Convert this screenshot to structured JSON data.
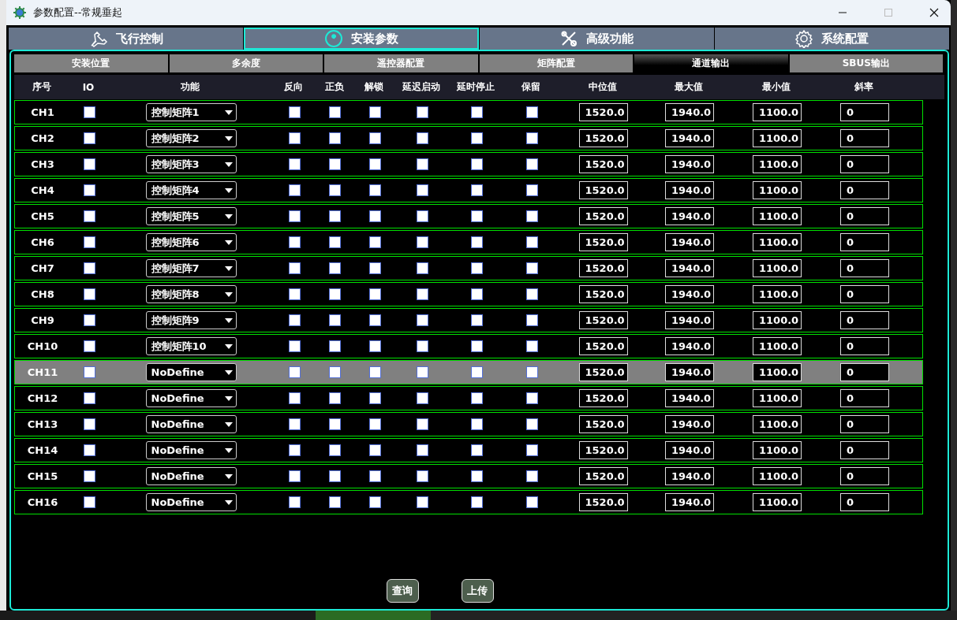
{
  "window": {
    "title": "参数配置--常规垂起"
  },
  "main_tabs": [
    {
      "label": "飞行控制",
      "selected": false
    },
    {
      "label": "安装参数",
      "selected": true
    },
    {
      "label": "高级功能",
      "selected": false
    },
    {
      "label": "系统配置",
      "selected": false
    }
  ],
  "sub_tabs": [
    {
      "label": "安装位置",
      "selected": false
    },
    {
      "label": "多余度",
      "selected": false
    },
    {
      "label": "遥控器配置",
      "selected": false
    },
    {
      "label": "矩阵配置",
      "selected": false
    },
    {
      "label": "通道输出",
      "selected": true
    },
    {
      "label": "SBUS输出",
      "selected": false
    }
  ],
  "table": {
    "columns": [
      "序号",
      "IO",
      "功能",
      "反向",
      "正负",
      "解锁",
      "延迟启动",
      "延时停止",
      "保留",
      "中位值",
      "最大值",
      "最小值",
      "斜率"
    ],
    "rows": [
      {
        "channel": "CH1",
        "selected": false,
        "checks": [
          {
            "checked": false
          },
          {
            "checked": false
          },
          {
            "checked": false
          },
          {
            "checked": false
          },
          {
            "checked": false
          },
          {
            "checked": false
          },
          {
            "checked": false
          }
        ],
        "function": "控制矩阵1",
        "mid": "1520.0",
        "max": "1940.0",
        "min": "1100.0",
        "slope": "0"
      },
      {
        "channel": "CH2",
        "selected": false,
        "checks": [
          {
            "checked": false
          },
          {
            "checked": false
          },
          {
            "checked": false
          },
          {
            "checked": false
          },
          {
            "checked": false
          },
          {
            "checked": false
          },
          {
            "checked": false
          }
        ],
        "function": "控制矩阵2",
        "mid": "1520.0",
        "max": "1940.0",
        "min": "1100.0",
        "slope": "0"
      },
      {
        "channel": "CH3",
        "selected": false,
        "checks": [
          {
            "checked": false
          },
          {
            "checked": false
          },
          {
            "checked": false
          },
          {
            "checked": false
          },
          {
            "checked": false
          },
          {
            "checked": false
          },
          {
            "checked": false
          }
        ],
        "function": "控制矩阵3",
        "mid": "1520.0",
        "max": "1940.0",
        "min": "1100.0",
        "slope": "0"
      },
      {
        "channel": "CH4",
        "selected": false,
        "checks": [
          {
            "checked": false
          },
          {
            "checked": false
          },
          {
            "checked": false
          },
          {
            "checked": false
          },
          {
            "checked": false
          },
          {
            "checked": false
          },
          {
            "checked": false
          }
        ],
        "function": "控制矩阵4",
        "mid": "1520.0",
        "max": "1940.0",
        "min": "1100.0",
        "slope": "0"
      },
      {
        "channel": "CH5",
        "selected": false,
        "checks": [
          {
            "checked": false
          },
          {
            "checked": false
          },
          {
            "checked": false
          },
          {
            "checked": false
          },
          {
            "checked": false
          },
          {
            "checked": false
          },
          {
            "checked": false
          }
        ],
        "function": "控制矩阵5",
        "mid": "1520.0",
        "max": "1940.0",
        "min": "1100.0",
        "slope": "0"
      },
      {
        "channel": "CH6",
        "selected": false,
        "checks": [
          {
            "checked": false
          },
          {
            "checked": false
          },
          {
            "checked": false
          },
          {
            "checked": false
          },
          {
            "checked": false
          },
          {
            "checked": false
          },
          {
            "checked": false
          }
        ],
        "function": "控制矩阵6",
        "mid": "1520.0",
        "max": "1940.0",
        "min": "1100.0",
        "slope": "0"
      },
      {
        "channel": "CH7",
        "selected": false,
        "checks": [
          {
            "checked": false
          },
          {
            "checked": false
          },
          {
            "checked": false
          },
          {
            "checked": false
          },
          {
            "checked": false
          },
          {
            "checked": false
          },
          {
            "checked": false
          }
        ],
        "function": "控制矩阵7",
        "mid": "1520.0",
        "max": "1940.0",
        "min": "1100.0",
        "slope": "0"
      },
      {
        "channel": "CH8",
        "selected": false,
        "checks": [
          {
            "checked": false
          },
          {
            "checked": false
          },
          {
            "checked": false
          },
          {
            "checked": false
          },
          {
            "checked": false
          },
          {
            "checked": false
          },
          {
            "checked": false
          }
        ],
        "function": "控制矩阵8",
        "mid": "1520.0",
        "max": "1940.0",
        "min": "1100.0",
        "slope": "0"
      },
      {
        "channel": "CH9",
        "selected": false,
        "checks": [
          {
            "checked": false
          },
          {
            "checked": false
          },
          {
            "checked": false
          },
          {
            "checked": false
          },
          {
            "checked": false
          },
          {
            "checked": false
          },
          {
            "checked": false
          }
        ],
        "function": "控制矩阵9",
        "mid": "1520.0",
        "max": "1940.0",
        "min": "1100.0",
        "slope": "0"
      },
      {
        "channel": "CH10",
        "selected": false,
        "checks": [
          {
            "checked": false
          },
          {
            "checked": false
          },
          {
            "checked": false
          },
          {
            "checked": false
          },
          {
            "checked": false
          },
          {
            "checked": false
          },
          {
            "checked": false
          }
        ],
        "function": "控制矩阵10",
        "mid": "1520.0",
        "max": "1940.0",
        "min": "1100.0",
        "slope": "0"
      },
      {
        "channel": "CH11",
        "selected": true,
        "checks": [
          {
            "checked": false
          },
          {
            "checked": false
          },
          {
            "checked": false
          },
          {
            "checked": false
          },
          {
            "checked": false
          },
          {
            "checked": false
          },
          {
            "checked": false
          }
        ],
        "function": "NoDefine",
        "mid": "1520.0",
        "max": "1940.0",
        "min": "1100.0",
        "slope": "0"
      },
      {
        "channel": "CH12",
        "selected": false,
        "checks": [
          {
            "checked": false
          },
          {
            "checked": false
          },
          {
            "checked": false
          },
          {
            "checked": false
          },
          {
            "checked": false
          },
          {
            "checked": false
          },
          {
            "checked": false
          }
        ],
        "function": "NoDefine",
        "mid": "1520.0",
        "max": "1940.0",
        "min": "1100.0",
        "slope": "0"
      },
      {
        "channel": "CH13",
        "selected": false,
        "checks": [
          {
            "checked": false
          },
          {
            "checked": false
          },
          {
            "checked": false
          },
          {
            "checked": false
          },
          {
            "checked": false
          },
          {
            "checked": false
          },
          {
            "checked": false
          }
        ],
        "function": "NoDefine",
        "mid": "1520.0",
        "max": "1940.0",
        "min": "1100.0",
        "slope": "0"
      },
      {
        "channel": "CH14",
        "selected": false,
        "checks": [
          {
            "checked": false
          },
          {
            "checked": false
          },
          {
            "checked": false
          },
          {
            "checked": false
          },
          {
            "checked": false
          },
          {
            "checked": false
          },
          {
            "checked": false
          }
        ],
        "function": "NoDefine",
        "mid": "1520.0",
        "max": "1940.0",
        "min": "1100.0",
        "slope": "0"
      },
      {
        "channel": "CH15",
        "selected": false,
        "checks": [
          {
            "checked": false
          },
          {
            "checked": false
          },
          {
            "checked": false
          },
          {
            "checked": false
          },
          {
            "checked": false
          },
          {
            "checked": false
          },
          {
            "checked": false
          }
        ],
        "function": "NoDefine",
        "mid": "1520.0",
        "max": "1940.0",
        "min": "1100.0",
        "slope": "0"
      },
      {
        "channel": "CH16",
        "selected": false,
        "checks": [
          {
            "checked": false
          },
          {
            "checked": false
          },
          {
            "checked": false
          },
          {
            "checked": false
          },
          {
            "checked": false
          },
          {
            "checked": false
          },
          {
            "checked": false
          }
        ],
        "function": "NoDefine",
        "mid": "1520.0",
        "max": "1940.0",
        "min": "1100.0",
        "slope": "0"
      }
    ]
  },
  "buttons": [
    "查询",
    "上传"
  ]
}
